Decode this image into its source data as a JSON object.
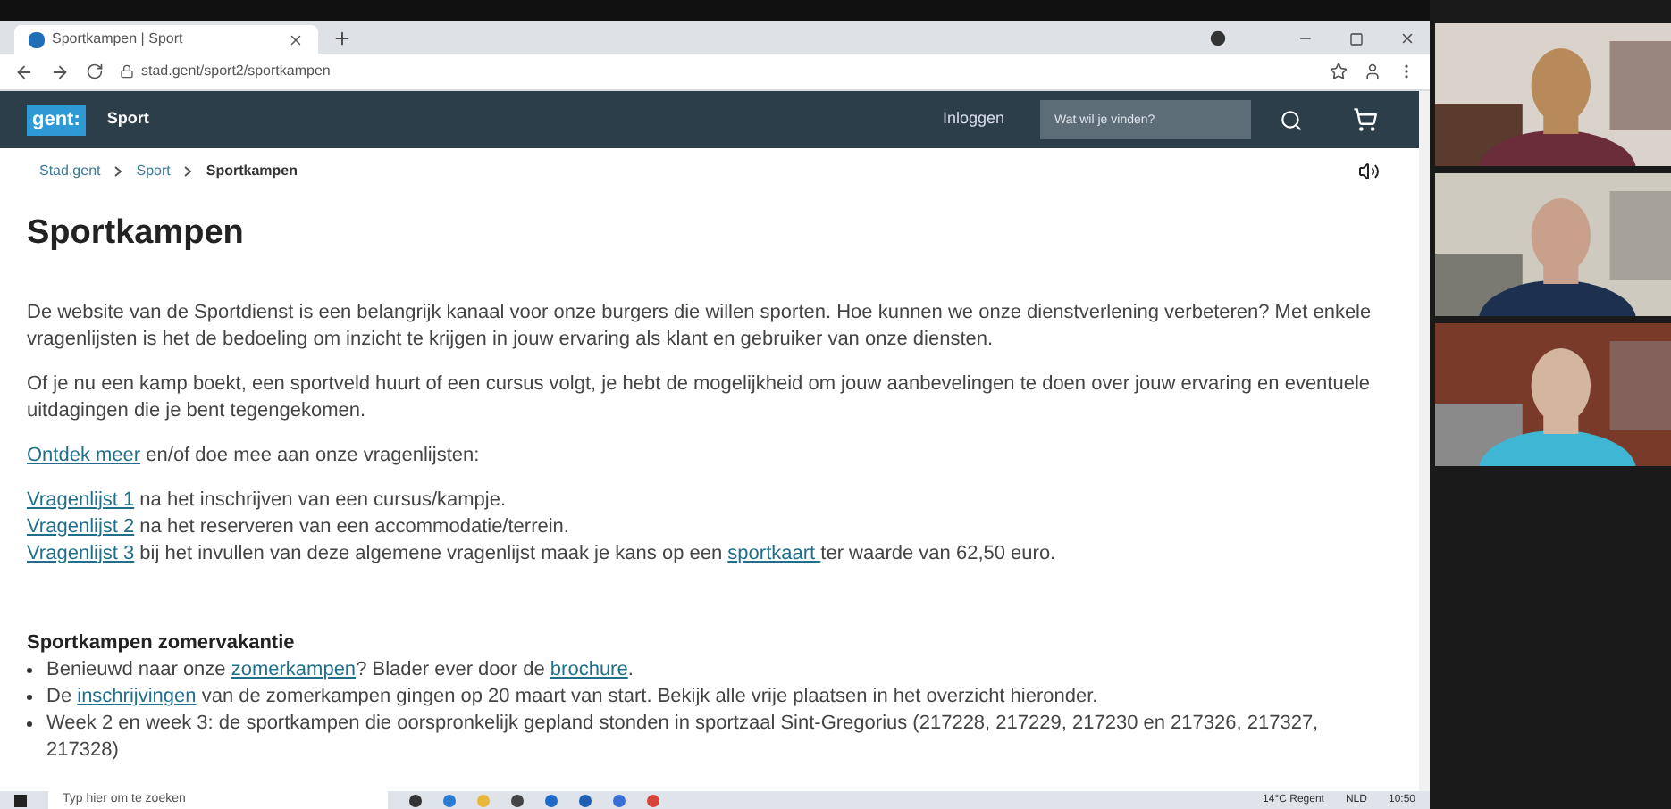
{
  "browser": {
    "tab_title": "Sportkampen | Sport",
    "url": "stad.gent/sport2/sportkampen"
  },
  "site_header": {
    "logo": "gent:",
    "section": "Sport",
    "login": "Inloggen",
    "search": {
      "placeholder": "Wat wil je vinden?"
    }
  },
  "breadcrumb": [
    "Stad.gent",
    "Sport",
    "Sportkampen"
  ],
  "heading": "Sportkampen",
  "paragraphs": [
    [
      {
        "text": "De website van de Sportdienst is een belangrijk kanaal voor onze burgers die willen sporten. Hoe kunnen we onze dienstverlening verbeteren? Met enkele vragenlijsten is het de bedoeling om inzicht te krijgen in jouw ervaring als klant en gebruiker van onze diensten.",
        "link": false
      }
    ],
    [
      {
        "text": "Of je nu een kamp boekt, een sportveld huurt of een cursus volgt, je hebt de mogelijkheid om jouw aanbevelingen te doen over jouw ervaring en eventuele uitdagingen die je bent tegengekomen.",
        "link": false
      }
    ],
    [
      {
        "text": "Ontdek meer",
        "link": true
      },
      {
        "text": " en/of doe mee aan onze vragenlijsten:",
        "link": false
      }
    ]
  ],
  "questionnaires": [
    [
      {
        "text": "Vragenlijst 1",
        "link": true
      },
      {
        "text": " na het inschrijven van een cursus/kampje.",
        "link": false
      }
    ],
    [
      {
        "text": "Vragenlijst 2",
        "link": true
      },
      {
        "text": " na het reserveren van een accommodatie/terrein.",
        "link": false
      }
    ],
    [
      {
        "text": "Vragenlijst 3",
        "link": true
      },
      {
        "text": " bij het invullen van deze algemene vragenlijst maak je kans op een ",
        "link": false
      },
      {
        "text": "sportkaart ",
        "link": true
      },
      {
        "text": "ter waarde van 62,50 euro.",
        "link": false
      }
    ]
  ],
  "section": {
    "title": "Sportkampen zomervakantie",
    "bullets": [
      [
        {
          "text": "Benieuwd naar onze ",
          "link": false
        },
        {
          "text": "zomerkampen",
          "link": true
        },
        {
          "text": "? Blader ever door de ",
          "link": false
        },
        {
          "text": "brochure",
          "link": true
        },
        {
          "text": ".",
          "link": false
        }
      ],
      [
        {
          "text": "De ",
          "link": false
        },
        {
          "text": "inschrijvingen",
          "link": true
        },
        {
          "text": " van de zomerkampen gingen op 20 maart van start. Bekijk alle vrije plaatsen in het overzicht hieronder.",
          "link": false
        }
      ],
      [
        {
          "text": "Week 2 en week 3: de sportkampen die oorspronkelijk gepland stonden in sportzaal Sint-Gregorius (217228, 217229, 217230 en 217326, 217327, 217328)",
          "link": false
        }
      ]
    ]
  },
  "taskbar": {
    "search": {
      "placeholder": "Typ hier om te zoeken"
    },
    "weather": "14°C Regent",
    "language": "NLD",
    "time": "10:50"
  },
  "participants": [
    {
      "kind": "picture"
    },
    {
      "kind": "picture"
    },
    {
      "kind": "picture"
    }
  ]
}
